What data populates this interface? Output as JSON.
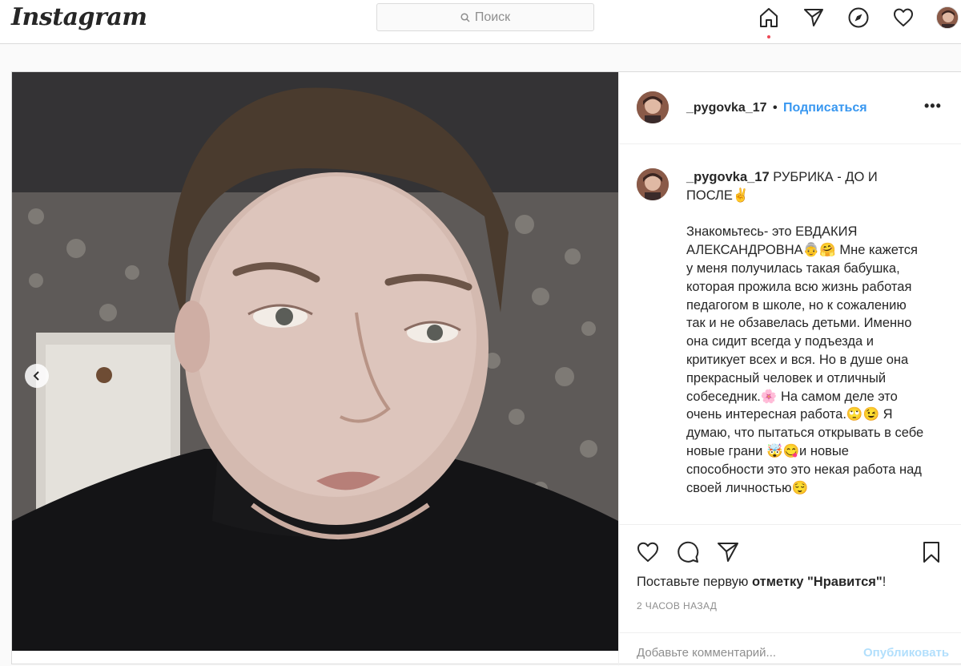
{
  "nav": {
    "logo": "Instagram",
    "search_placeholder": "Поиск"
  },
  "post": {
    "username": "_pygovka_17",
    "separator": "•",
    "follow_label": "Подписаться",
    "more_label": "•••",
    "caption": {
      "username": "_pygovka_17",
      "title": " РУБРИКА - ДО И ПОСЛЕ✌️",
      "body": "Знакомьтесь- это ЕВДАКИЯ АЛЕКСАНДРОВНА👵🤗 Мне кажется у меня получилась такая бабушка, которая прожила всю жизнь работая педагогом в школе, но к сожалению так и не обзавелась детьми. Именно она сидит всегда у подъезда и критикует всех и вся. Но в душе она прекрасный человек и отличный собеседник.🌸 На самом деле это очень интересная работа.🙄😉 Я думаю, что пытаться открывать в себе новые грани 🤯😋и новые способности это это некая работа над своей личностью😌"
    },
    "likes_prefix": "Поставьте первую ",
    "likes_bold": "отметку \"Нравится\"",
    "likes_suffix": "!",
    "time": "2 ЧАСОВ НАЗАД",
    "comment_placeholder": "Добавьте комментарий...",
    "publish_label": "Опубликовать"
  },
  "colors": {
    "accent": "#3897f0",
    "notification": "#ed4956"
  }
}
